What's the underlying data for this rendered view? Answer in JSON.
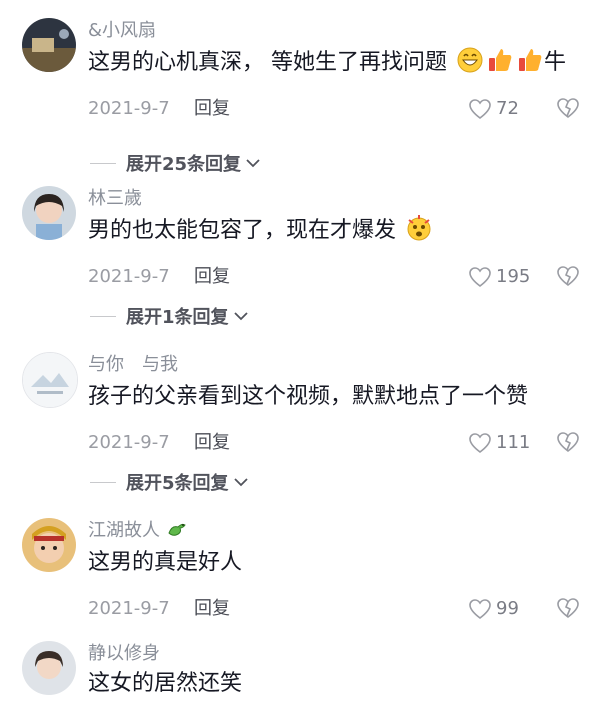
{
  "comments": [
    {
      "username": "&小风扇",
      "text": "这男的心机真深， 等她生了再找问题",
      "suffix": "牛",
      "date": "2021-9-7",
      "reply_label": "回复",
      "likes": "72",
      "expand_label": "展开25条回复",
      "emoji": [
        "grinning-face",
        "thumbs-up",
        "thumbs-up"
      ]
    },
    {
      "username": "林三歲",
      "text": "男的也太能包容了，现在才爆发",
      "date": "2021-9-7",
      "reply_label": "回复",
      "likes": "195",
      "expand_label": "展开1条回复",
      "emoji": [
        "exploding-face"
      ]
    },
    {
      "username": "与你　与我",
      "text": "孩子的父亲看到这个视频，默默地点了一个赞",
      "date": "2021-9-7",
      "reply_label": "回复",
      "likes": "111",
      "expand_label": "展开5条回复"
    },
    {
      "username": "江湖故人",
      "text": "这男的真是好人",
      "date": "2021-9-7",
      "reply_label": "回复",
      "likes": "99",
      "emoji": [
        "dragon"
      ]
    },
    {
      "username": "静以修身",
      "text": "这女的居然还笑"
    }
  ],
  "colors": {
    "text": "#161823",
    "muted": "#9a9ca3",
    "username": "#8a8f99"
  }
}
